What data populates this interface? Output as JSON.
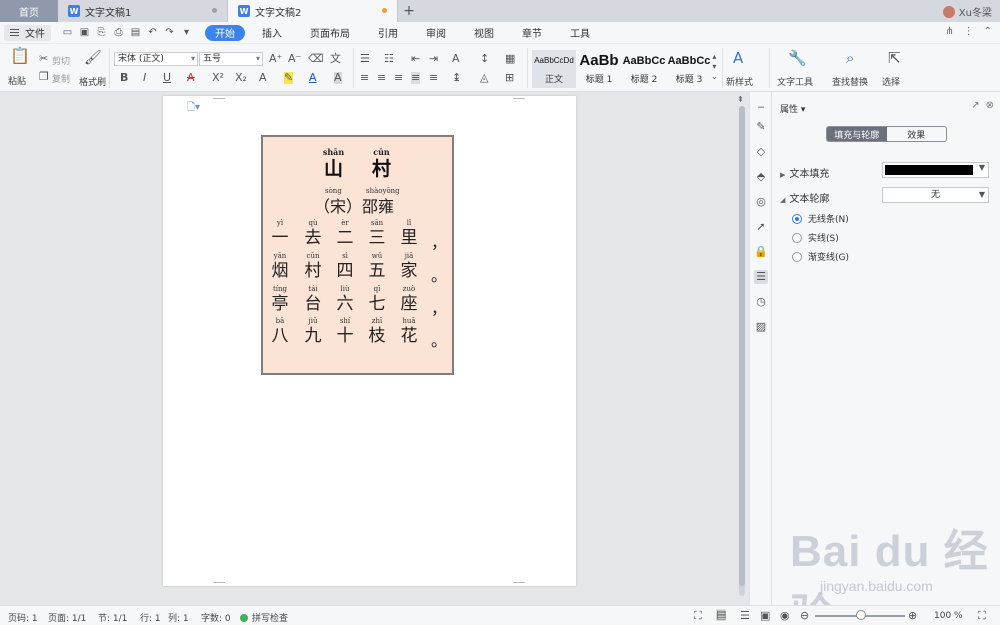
{
  "tabs": {
    "home": "首页",
    "doc1": "文字文稿1",
    "doc2": "文字文稿2",
    "user": "Xu冬梁"
  },
  "menu": {
    "file": "文件",
    "items": [
      "开始",
      "插入",
      "页面布局",
      "引用",
      "审阅",
      "视图",
      "章节",
      "工具"
    ]
  },
  "ribbon": {
    "paste": "粘贴",
    "cut": "剪切",
    "copy": "复制",
    "format_painter": "格式刷",
    "font_name": "宋体 (正文)",
    "font_size": "五号",
    "styles": [
      {
        "sample": "AaBbCcDd",
        "label": "正文"
      },
      {
        "sample": "AaBb",
        "label": "标题 1"
      },
      {
        "sample": "AaBbCc",
        "label": "标题 2"
      },
      {
        "sample": "AaBbCc",
        "label": "标题 3"
      }
    ],
    "new_style": "新样式",
    "text_tools": "文字工具",
    "find_replace": "查找替换",
    "select": "选择"
  },
  "poem": {
    "title_pinyin": [
      "shān",
      "cūn"
    ],
    "title": [
      "山",
      "村"
    ],
    "author_pinyin1": "sòng",
    "author_pinyin2": "shàoyōng",
    "author": "（宋）邵雍",
    "lines": [
      {
        "pinyin": [
          "yì",
          "qù",
          "èr",
          "sān",
          "lǐ"
        ],
        "chars": [
          "一",
          "去",
          "二",
          "三",
          "里"
        ],
        "punct": "，"
      },
      {
        "pinyin": [
          "yān",
          "cūn",
          "sì",
          "wǔ",
          "jiā"
        ],
        "chars": [
          "烟",
          "村",
          "四",
          "五",
          "家"
        ],
        "punct": "。"
      },
      {
        "pinyin": [
          "tíng",
          "tái",
          "liù",
          "qī",
          "zuò"
        ],
        "chars": [
          "亭",
          "台",
          "六",
          "七",
          "座"
        ],
        "punct": "，"
      },
      {
        "pinyin": [
          "bā",
          "jiǔ",
          "shí",
          "zhī",
          "huā"
        ],
        "chars": [
          "八",
          "九",
          "十",
          "枝",
          "花"
        ],
        "punct": "。"
      }
    ]
  },
  "props": {
    "title": "属性",
    "seg_fill": "填充与轮廓",
    "seg_effect": "效果",
    "text_fill": "文本填充",
    "text_outline": "文本轮廓",
    "outline_value": "无",
    "radio_none": "无线条(N)",
    "radio_solid": "实线(S)",
    "radio_gradient": "渐变线(G)",
    "fill_color": "#000000"
  },
  "status": {
    "page_no": "页码: 1",
    "pages": "页面: 1/1",
    "section": "节: 1/1",
    "row": "行: 1",
    "col": "列: 1",
    "words": "字数: 0",
    "spell": "拼写检查",
    "zoom": "100 %"
  },
  "watermark": {
    "brand": "Bai du 经验",
    "url": "jingyan.baidu.com"
  }
}
